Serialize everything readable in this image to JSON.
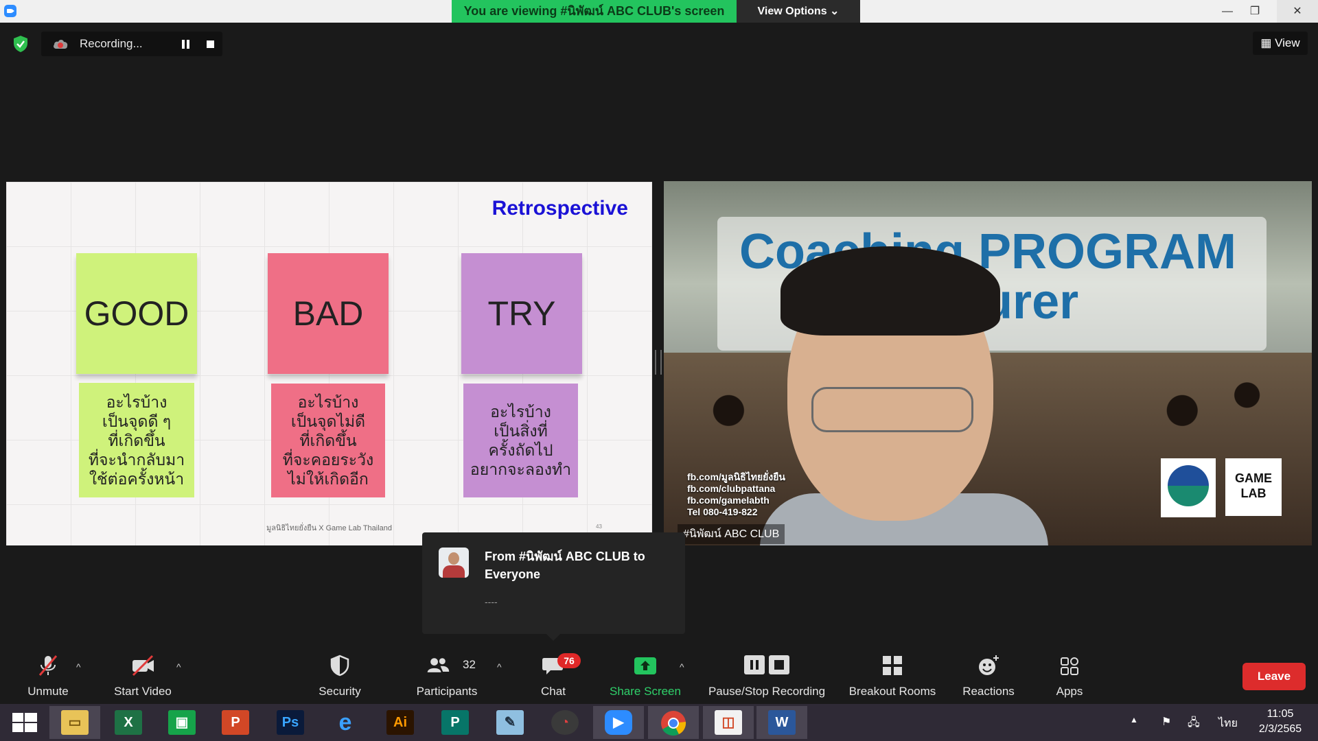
{
  "window": {
    "viewing_banner": "You are viewing #นิพัฒน์ ABC CLUB's screen",
    "view_options": "View Options ⌄"
  },
  "recording": {
    "label": "Recording..."
  },
  "view_button": "View",
  "slide": {
    "title": "Retrospective",
    "notes": [
      {
        "label": "GOOD",
        "desc": "อะไรบ้าง\nเป็นจุดดี ๆ\nที่เกิดขึ้น\nที่จะนำกลับมา\nใช้ต่อครั้งหน้า",
        "color": "#cff27b"
      },
      {
        "label": "BAD",
        "desc": "อะไรบ้าง\nเป็นจุดไม่ดี\nที่เกิดขึ้น\nที่จะคอยระวัง\nไม่ให้เกิดอีก",
        "color": "#ef6f86"
      },
      {
        "label": "TRY",
        "desc": "อะไรบ้าง\nเป็นสิ่งที่\nครั้งถัดไป\nอยากจะลองทำ",
        "color": "#c58fd2"
      }
    ],
    "footer": "มูลนิธิไทยยั่งยืน X Game Lab Thailand",
    "page_number": "43"
  },
  "video": {
    "overlay_title": "Coaching PROGRAM",
    "overlay_sub": "ecturer",
    "contacts": [
      "fb.com/มูลนิธิไทยยั่งยืน",
      "fb.com/clubpattana",
      "fb.com/gamelabth",
      "Tel 080-419-822"
    ],
    "logo_text": "GAME LAB",
    "speaker_name": "#นิพัฒน์ ABC CLUB"
  },
  "chat_toast": {
    "from": "From #นิพัฒน์ ABC CLUB to Everyone",
    "message": "----"
  },
  "toolbar": {
    "unmute": "Unmute",
    "start_video": "Start Video",
    "security": "Security",
    "participants": "Participants",
    "participants_count": "32",
    "chat": "Chat",
    "chat_badge": "76",
    "share_screen": "Share Screen",
    "pause_stop_recording": "Pause/Stop Recording",
    "breakout_rooms": "Breakout Rooms",
    "reactions": "Reactions",
    "apps": "Apps",
    "leave": "Leave"
  },
  "taskbar": {
    "apps": [
      "windows-start",
      "file-explorer",
      "excel",
      "store",
      "powerpoint",
      "photoshop",
      "internet-explorer",
      "illustrator",
      "publisher",
      "notepad",
      "photoscape",
      "zoom",
      "chrome",
      "office",
      "word"
    ],
    "language": "ไทย",
    "time": "11:05",
    "date": "2/3/2565"
  },
  "colors": {
    "share_green": "#23c45e",
    "leave_red": "#dd2c2c",
    "badge_red": "#e02828",
    "zoom_blue": "#2d8cff"
  }
}
